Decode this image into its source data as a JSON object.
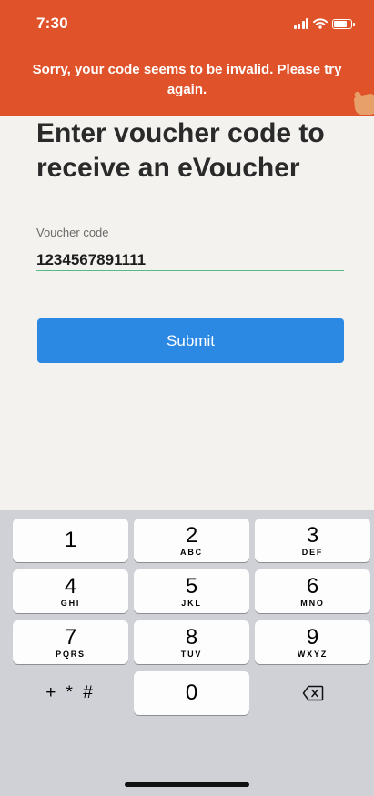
{
  "status_bar": {
    "time": "7:30"
  },
  "toast": {
    "message": "Sorry, your code seems to be invalid. Please try again."
  },
  "page": {
    "title": "Enter voucher code to receive an eVoucher"
  },
  "form": {
    "voucher_label": "Voucher code",
    "voucher_value": "1234567891111",
    "submit_label": "Submit"
  },
  "keypad": {
    "keys": [
      {
        "num": "1",
        "letters": ""
      },
      {
        "num": "2",
        "letters": "ABC"
      },
      {
        "num": "3",
        "letters": "DEF"
      },
      {
        "num": "4",
        "letters": "GHI"
      },
      {
        "num": "5",
        "letters": "JKL"
      },
      {
        "num": "6",
        "letters": "MNO"
      },
      {
        "num": "7",
        "letters": "PQRS"
      },
      {
        "num": "8",
        "letters": "TUV"
      },
      {
        "num": "9",
        "letters": "WXYZ"
      },
      {
        "num": "0",
        "letters": ""
      }
    ],
    "symbols_label": "+ * #"
  },
  "colors": {
    "header": "#e0522a",
    "button": "#2c89e3",
    "underline": "#55bb84"
  },
  "icons": [
    "signal-icon",
    "wifi-icon",
    "battery-icon",
    "hand-icon",
    "backspace-icon"
  ]
}
